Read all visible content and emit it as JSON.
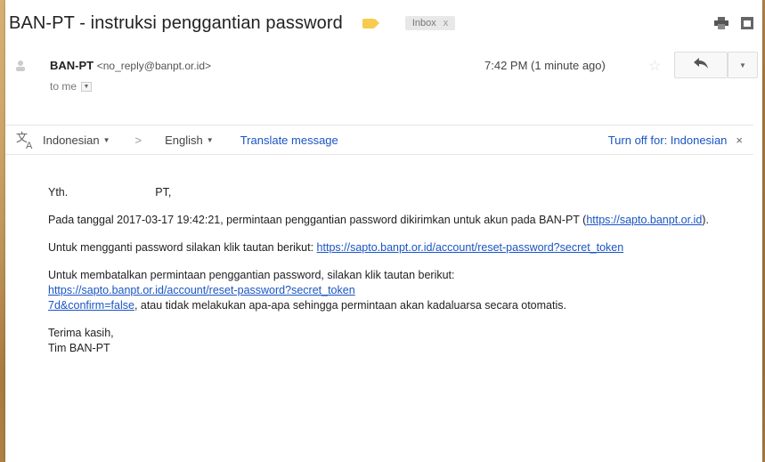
{
  "email": {
    "subject": "BAN-PT - instruksi penggantian password",
    "label": "Inbox",
    "label_close": "x",
    "sender_name": "BAN-PT",
    "sender_email": "<no_reply@banpt.or.id>",
    "recipient": "to me",
    "time": "7:42 PM (1 minute ago)"
  },
  "translate": {
    "from_lang": "Indonesian",
    "to_lang": "English",
    "translate_link": "Translate message",
    "turn_off": "Turn off for: Indonesian",
    "close": "×"
  },
  "body": {
    "greeting_yth": "Yth.",
    "greeting_pt": "PT,",
    "p1_text": "Pada tanggal 2017-03-17 19:42:21, permintaan penggantian password dikirimkan untuk akun pada BAN-PT (",
    "p1_link": "https://sapto.banpt.or.id",
    "p1_end": ").",
    "p2_text": "Untuk mengganti password silakan klik tautan berikut: ",
    "p2_link": "https://sapto.banpt.or.id/account/reset-password?secret_token",
    "p3_text": "Untuk membatalkan permintaan penggantian password, silakan klik tautan berikut:",
    "p3_link_a": "https://sapto.banpt.or.id/account/reset-password?secret_token",
    "p3_link_b": "7d&confirm=false",
    "p3_end": ", atau tidak melakukan apa-apa sehingga permintaan akan kadaluarsa secara otomatis.",
    "closing_1": "Terima kasih,",
    "closing_2": "Tim BAN-PT"
  },
  "icons": [
    "print-icon",
    "new-window-icon",
    "person-avatar-icon",
    "star-icon",
    "reply-icon",
    "more-dropdown-icon",
    "translate-icon"
  ],
  "colors": {
    "link": "#1a55c4",
    "importance_marker": "#f7cb4d",
    "background_texture": "#b58a4f"
  }
}
